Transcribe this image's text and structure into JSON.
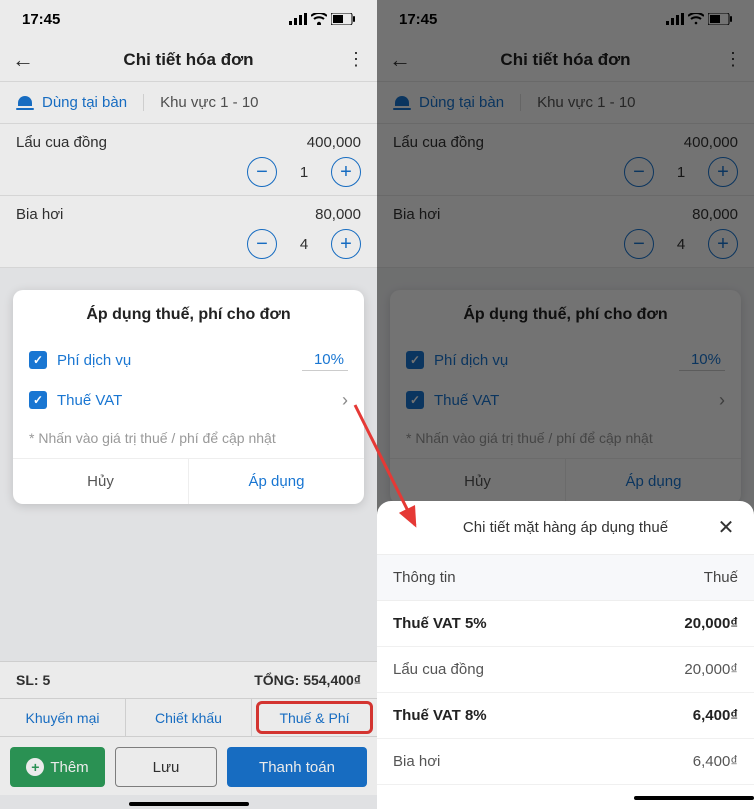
{
  "statusbar": {
    "time": "17:45"
  },
  "header": {
    "title": "Chi tiết hóa đơn"
  },
  "subheader": {
    "mode": "Dùng tại bàn",
    "location": "Khu vực 1 - 10"
  },
  "items": [
    {
      "name": "Lẩu cua đồng",
      "price": "400,000",
      "qty": "1"
    },
    {
      "name": "Bia hơi",
      "price": "80,000",
      "qty": "4"
    }
  ],
  "tax_modal": {
    "title": "Áp dụng thuế, phí cho đơn",
    "service_fee_label": "Phí dịch vụ",
    "service_fee_value": "10%",
    "vat_label": "Thuế VAT",
    "hint": "* Nhấn vào giá trị thuế / phí để cập nhật",
    "cancel": "Hủy",
    "apply": "Áp dụng"
  },
  "summary": {
    "qty_label": "SL: 5",
    "total_label": "TỔNG: 554,400₫"
  },
  "tabs": {
    "promo": "Khuyến mại",
    "discount": "Chiết khấu",
    "tax": "Thuế & Phí"
  },
  "actions": {
    "add": "Thêm",
    "save": "Lưu",
    "pay": "Thanh toán"
  },
  "sheet": {
    "title": "Chi tiết mặt hàng áp dụng thuế",
    "col_info": "Thông tin",
    "col_tax": "Thuế",
    "rows": [
      {
        "label": "Thuế VAT 5%",
        "value": "20,000₫",
        "bold": true
      },
      {
        "label": "Lẩu cua đồng",
        "value": "20,000₫",
        "bold": false
      },
      {
        "label": "Thuế VAT 8%",
        "value": "6,400₫",
        "bold": true
      },
      {
        "label": "Bia hơi",
        "value": "6,400₫",
        "bold": false
      }
    ]
  }
}
